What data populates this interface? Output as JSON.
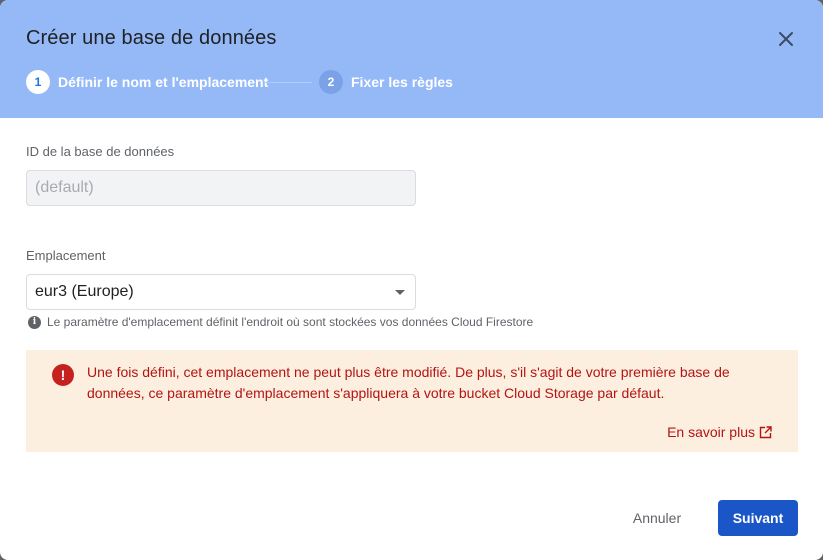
{
  "dialog": {
    "title": "Créer une base de données",
    "close_icon": "close-icon"
  },
  "stepper": {
    "steps": [
      {
        "number": "1",
        "label": "Définir le nom et l'emplacement",
        "active": true
      },
      {
        "number": "2",
        "label": "Fixer les règles",
        "active": false
      }
    ]
  },
  "form": {
    "db_id": {
      "label": "ID de la base de données",
      "placeholder": "(default)"
    },
    "location": {
      "label": "Emplacement",
      "value": "eur3 (Europe)",
      "hint": "Le paramètre d'emplacement définit l'endroit où sont stockées vos données Cloud Firestore"
    }
  },
  "warning": {
    "text": "Une fois défini, cet emplacement ne peut plus être modifié. De plus, s'il s'agit de votre première base de données, ce paramètre d'emplacement s'appliquera à votre bucket Cloud Storage par défaut.",
    "link": "En savoir plus",
    "icon": "error-icon",
    "color": "#b31412",
    "background": "#fdefe0"
  },
  "actions": {
    "cancel": "Annuler",
    "next": "Suivant"
  },
  "colors": {
    "header": "#95b9f7",
    "primary": "#1a56c8"
  }
}
